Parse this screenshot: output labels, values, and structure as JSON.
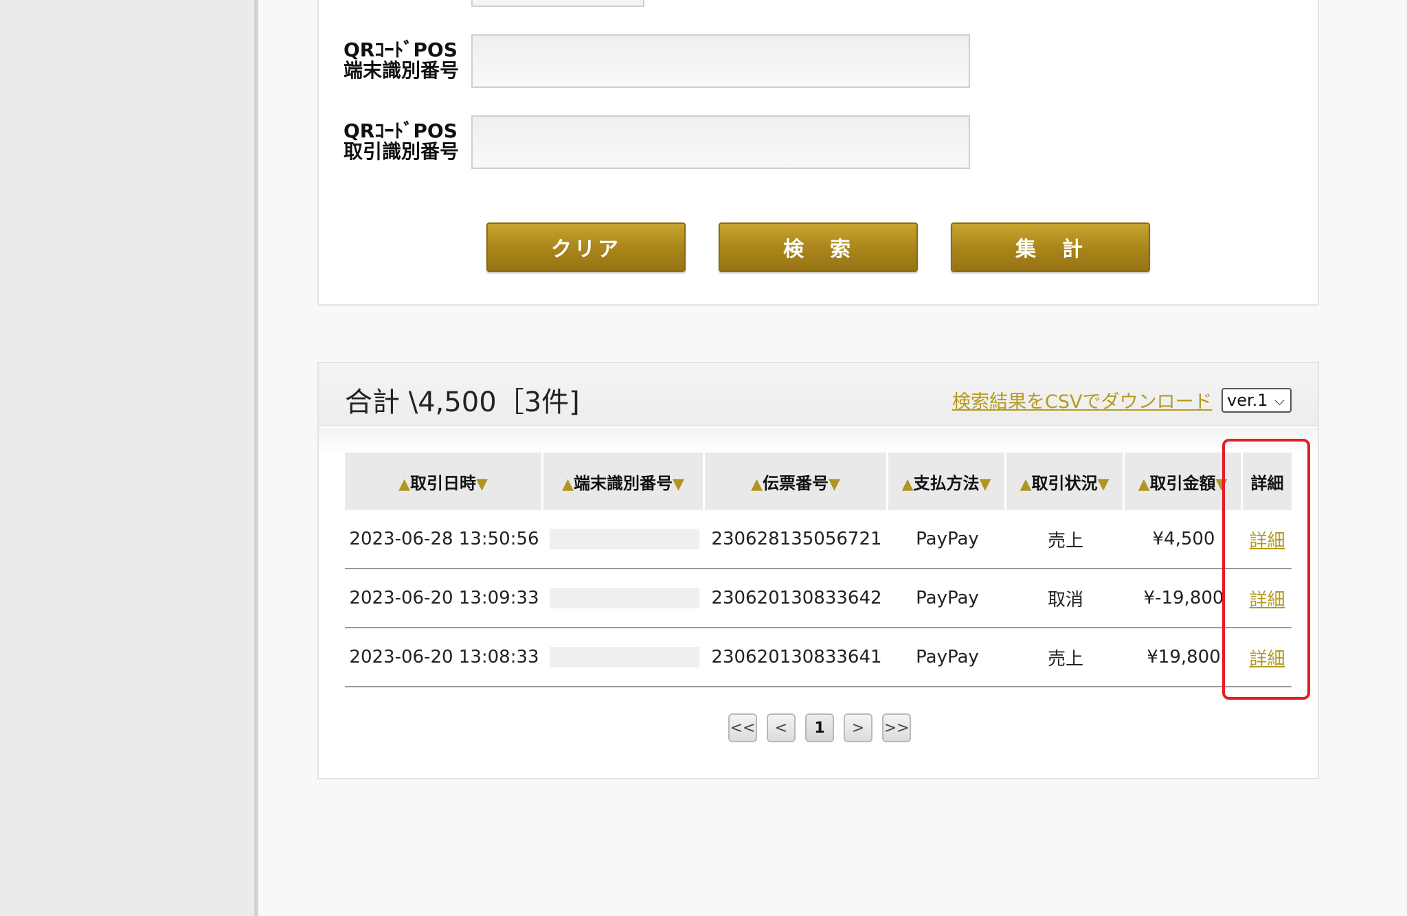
{
  "search": {
    "fields": [
      {
        "label": "QRｺｰﾄﾞPOS\n端末識別番号",
        "value": ""
      },
      {
        "label": "QRｺｰﾄﾞPOS\n取引識別番号",
        "value": ""
      }
    ],
    "buttons": {
      "clear": "クリア",
      "search": "検　索",
      "aggregate": "集　計"
    }
  },
  "results": {
    "total": "合計 \\4,500［3件]",
    "csv_link": "検索結果をCSVでダウンロード",
    "version_select": "ver.1",
    "columns": [
      "取引日時",
      "端末識別番号",
      "伝票番号",
      "支払方法",
      "取引状況",
      "取引金額",
      "詳細"
    ],
    "rows": [
      {
        "datetime": "2023-06-28 13:50:56",
        "terminal": "",
        "slip": "230628135056721",
        "method": "PayPay",
        "status": "売上",
        "amount": "¥4,500",
        "detail": "詳細"
      },
      {
        "datetime": "2023-06-20 13:09:33",
        "terminal": "",
        "slip": "230620130833642",
        "method": "PayPay",
        "status": "取消",
        "amount": "¥-19,800",
        "detail": "詳細"
      },
      {
        "datetime": "2023-06-20 13:08:33",
        "terminal": "",
        "slip": "230620130833641",
        "method": "PayPay",
        "status": "売上",
        "amount": "¥19,800",
        "detail": "詳細"
      }
    ]
  },
  "pagination": {
    "first": "<<",
    "prev": "<",
    "current": "1",
    "next": ">",
    "last": ">>"
  },
  "icons": {
    "sort_asc": "▲",
    "sort_desc": "▼",
    "select_chevron": "⌵"
  },
  "colors": {
    "accent_gold": "#b49b1e",
    "button_gold": "#a8841a",
    "highlight_red": "#e51e24"
  }
}
